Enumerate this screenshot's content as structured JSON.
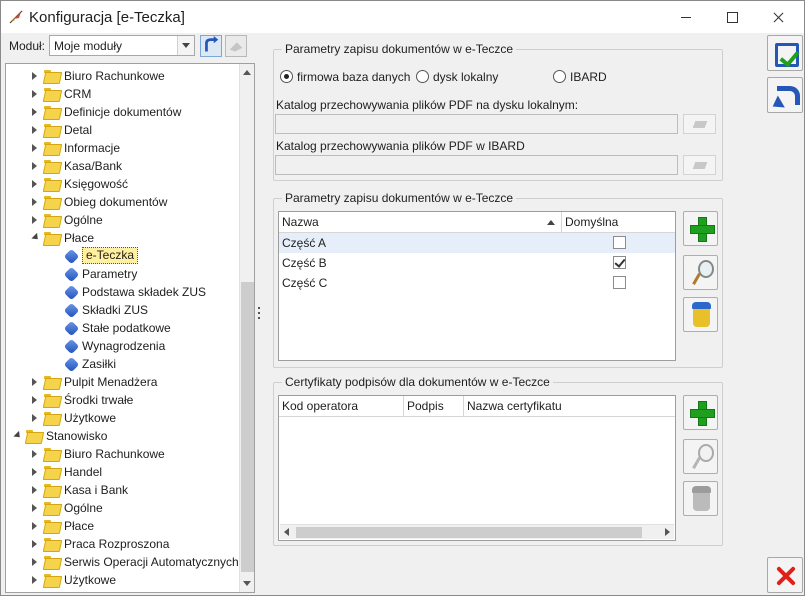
{
  "window": {
    "title": "Konfiguracja [e-Teczka]"
  },
  "module": {
    "label": "Moduł:",
    "selected": "Moje moduły"
  },
  "tree": {
    "rows": [
      {
        "label": "Biuro Rachunkowe",
        "kind": "folder",
        "expander": "closed",
        "level": 1
      },
      {
        "label": "CRM",
        "kind": "folder",
        "expander": "closed",
        "level": 1
      },
      {
        "label": "Definicje dokumentów",
        "kind": "folder",
        "expander": "closed",
        "level": 1
      },
      {
        "label": "Detal",
        "kind": "folder",
        "expander": "closed",
        "level": 1
      },
      {
        "label": "Informacje",
        "kind": "folder",
        "expander": "closed",
        "level": 1
      },
      {
        "label": "Kasa/Bank",
        "kind": "folder",
        "expander": "closed",
        "level": 1
      },
      {
        "label": "Księgowość",
        "kind": "folder",
        "expander": "closed",
        "level": 1
      },
      {
        "label": "Obieg dokumentów",
        "kind": "folder",
        "expander": "closed",
        "level": 1
      },
      {
        "label": "Ogólne",
        "kind": "folder",
        "expander": "closed",
        "level": 1
      },
      {
        "label": "Płace",
        "kind": "folder",
        "expander": "open",
        "level": 1
      },
      {
        "label": "e-Teczka",
        "kind": "leaf",
        "level": 2,
        "selected": true
      },
      {
        "label": "Parametry",
        "kind": "leaf",
        "level": 2
      },
      {
        "label": "Podstawa składek ZUS",
        "kind": "leaf",
        "level": 2
      },
      {
        "label": "Składki ZUS",
        "kind": "leaf",
        "level": 2
      },
      {
        "label": "Stałe podatkowe",
        "kind": "leaf",
        "level": 2
      },
      {
        "label": "Wynagrodzenia",
        "kind": "leaf",
        "level": 2
      },
      {
        "label": "Zasiłki",
        "kind": "leaf",
        "level": 2
      },
      {
        "label": "Pulpit Menadżera",
        "kind": "folder",
        "expander": "closed",
        "level": 1
      },
      {
        "label": "Środki trwałe",
        "kind": "folder",
        "expander": "closed",
        "level": 1
      },
      {
        "label": "Użytkowe",
        "kind": "folder",
        "expander": "closed",
        "level": 1
      },
      {
        "label": "Stanowisko",
        "kind": "folder",
        "expander": "open",
        "level": 0
      },
      {
        "label": "Biuro Rachunkowe",
        "kind": "folder",
        "expander": "closed",
        "level": 1
      },
      {
        "label": "Handel",
        "kind": "folder",
        "expander": "closed",
        "level": 1
      },
      {
        "label": "Kasa i Bank",
        "kind": "folder",
        "expander": "closed",
        "level": 1
      },
      {
        "label": "Ogólne",
        "kind": "folder",
        "expander": "closed",
        "level": 1
      },
      {
        "label": "Płace",
        "kind": "folder",
        "expander": "closed",
        "level": 1
      },
      {
        "label": "Praca Rozproszona",
        "kind": "folder",
        "expander": "closed",
        "level": 1
      },
      {
        "label": "Serwis Operacji Automatycznych",
        "kind": "folder",
        "expander": "closed",
        "level": 1
      },
      {
        "label": "Użytkowe",
        "kind": "folder",
        "expander": "closed",
        "level": 1
      }
    ]
  },
  "storage": {
    "title": "Parametry zapisu dokumentów w e-Teczce",
    "options": [
      {
        "label": "firmowa baza danych",
        "checked": true
      },
      {
        "label": "dysk lokalny",
        "checked": false
      },
      {
        "label": "IBARD",
        "checked": false
      }
    ],
    "local_dir_label": "Katalog przechowywania plików PDF na dysku lokalnym:",
    "local_dir_value": "",
    "ibard_dir_label": "Katalog przechowywania plików PDF w IBARD",
    "ibard_dir_value": ""
  },
  "parts": {
    "title": "Parametry zapisu dokumentów w e-Teczce",
    "columns": [
      "Nazwa",
      "Domyślna"
    ],
    "rows": [
      {
        "name": "Część A",
        "default": false,
        "selected": true
      },
      {
        "name": "Część B",
        "default": true,
        "selected": false
      },
      {
        "name": "Część C",
        "default": false,
        "selected": false
      }
    ]
  },
  "certs": {
    "title": "Certyfikaty podpisów dla dokumentów w e-Teczce",
    "columns": [
      "Kod operatora",
      "Podpis",
      "Nazwa certyfikatu"
    ]
  },
  "icons": {
    "app": "feather-icon",
    "save": "save-icon",
    "back": "undo-icon",
    "close": "close-x-icon"
  },
  "colors": {
    "selection": "#fff0a0",
    "accent": "#2457b8",
    "add": "#1ea01e",
    "cancel": "#e0201a"
  }
}
